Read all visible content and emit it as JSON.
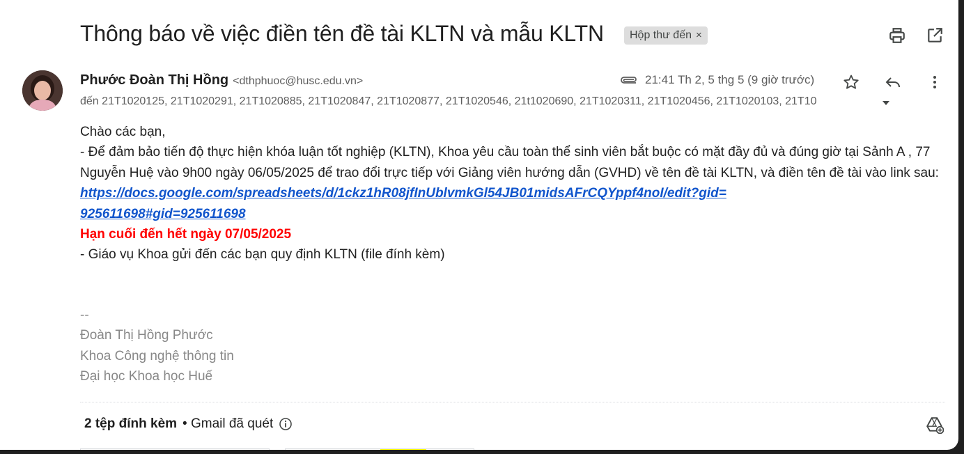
{
  "email": {
    "subject": "Thông báo về việc điền tên đề tài KLTN và mẫu KLTN",
    "label": "Hộp thư đến",
    "label_close": "×",
    "sender_name": "Phước Đoàn Thị Hồng",
    "sender_email": "<dthphuoc@husc.edu.vn>",
    "timestamp": "21:41 Th 2, 5 thg 5 (9 giờ trước)",
    "recipients": "đến 21T1020125, 21T1020291, 21T1020885, 21T1020847, 21T1020877, 21T1020546, 21t1020690, 21T1020311, 21T1020456, 21T1020103, 21T10"
  },
  "body": {
    "greeting": "Chào các bạn,",
    "para1": "- Để đảm bảo tiến độ thực hiện khóa luận tốt nghiệp (KLTN), Khoa yêu cầu toàn thể sinh viên bắt buộc có mặt đầy đủ và đúng giờ tại Sảnh A , 77 Nguyễn Huệ vào 9h00 ngày 06/05/2025 để trao đổi trực tiếp với Giảng viên hướng dẫn (GVHD) về tên đề tài KLTN, và điền tên đề tài vào link sau: ",
    "link_line1": "https://docs.google.com/spreadsheets/d/1ckz1hR08jfInUblvmkGl54JB01midsAFrCQYppf4noI/edit?gid=",
    "link_line2": "925611698#gid=925611698",
    "deadline": "Hạn cuối đến hết ngày 07/05/2025",
    "para2": "- Giáo vụ Khoa gửi đến các bạn quy định KLTN (file đính kèm)"
  },
  "signature": {
    "sep": "--",
    "name": "Đoàn Thị Hồng Phước",
    "dept": "Khoa Công nghệ thông tin",
    "org": "Đại học Khoa học Huế"
  },
  "attachments": {
    "count": "2 tệp đính kèm",
    "scan": "• Gmail đã quét"
  },
  "icons": {
    "print": "print-icon",
    "open_new_window": "open-in-new-icon",
    "attachment": "paperclip-icon",
    "star": "star-icon",
    "reply": "reply-icon",
    "more": "more-vert-icon",
    "recipients_expand": "caret-down-icon",
    "info": "info-icon",
    "drive": "add-to-drive-icon"
  },
  "colors": {
    "link": "#1155cc",
    "deadline": "#ff0000",
    "signature": "#888888"
  }
}
